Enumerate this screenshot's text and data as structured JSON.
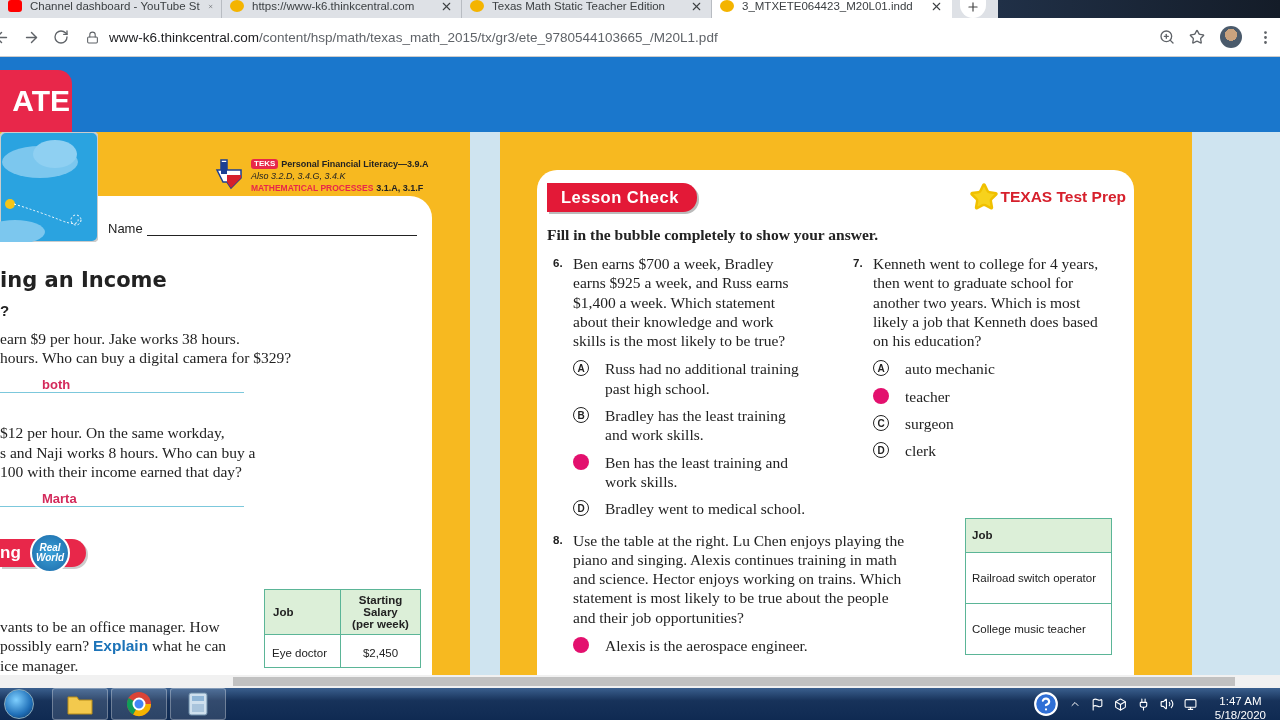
{
  "browser": {
    "tabs": [
      {
        "title": "Channel dashboard - YouTube St",
        "kind": "youtube",
        "selected": false
      },
      {
        "title": "https://www-k6.thinkcentral.com",
        "kind": "site",
        "selected": false
      },
      {
        "title": "Texas Math Static Teacher Edition",
        "kind": "site",
        "selected": false
      },
      {
        "title": "3_MTXETE064423_M20L01.indd",
        "kind": "site",
        "selected": true
      }
    ],
    "url": {
      "host": "www-k6.thinkcentral.com",
      "path": "/content/hsp/math/texas_math_2015/tx/gr3/ete_9780544103665_/M20L1.pdf"
    }
  },
  "viewer": {
    "banner_badge": "ATE"
  },
  "left_page": {
    "teks": {
      "badge": "TEKS",
      "title": "Personal Financial Literacy—3.9.A",
      "also": "Also 3.2.D, 3.4.G, 3.4.K",
      "processes_label": "MATHEMATICAL PROCESSES",
      "processes": "3.1.A, 3.1.F"
    },
    "name_label": "Name",
    "heading": "ing an Income",
    "subheading": "?",
    "problems": [
      {
        "text": "earn $9 per hour. Jake works 38 hours.\nhours. Who can buy a digital camera for $329?",
        "answer": "both"
      },
      {
        "text": "$12 per hour. On the same workday,\ns and Naji works 8 hours. Who can buy a\n100 with their income earned that day?",
        "answer": "Marta"
      }
    ],
    "section_pill": "ng",
    "section_badge": "Real\nWorld",
    "final_problem": {
      "before": "vants to be an office manager. How\npossibly earn? ",
      "term": "Explain",
      "after": " what he can\nice manager."
    },
    "table": {
      "columns": [
        "Job",
        "Starting Salary\n(per week)"
      ],
      "rows": [
        [
          "Eye doctor",
          "$2,450"
        ]
      ]
    }
  },
  "right_page": {
    "lesson_check": "Lesson Check",
    "test_prep": "TEXAS Test Prep",
    "instruction": "Fill in the bubble completely to show your answer.",
    "questions": [
      {
        "number": "6.",
        "text": "Ben earns $700 a week, Bradley\nearns $925 a week, and Russ earns\n$1,400 a week. Which statement\nabout their knowledge and work\nskills is the most likely to be true?",
        "options": [
          {
            "letter": "A",
            "text": "Russ had no additional training\npast high school.",
            "selected": false
          },
          {
            "letter": "B",
            "text": "Bradley has the least training\nand work skills.",
            "selected": false
          },
          {
            "text": "Ben has the least training and\nwork skills.",
            "selected": true
          },
          {
            "letter": "D",
            "text": "Bradley went to medical school.",
            "selected": false
          }
        ]
      },
      {
        "number": "7.",
        "text": "Kenneth went to college for 4 years,\nthen went to graduate school for\nanother two years. Which is most\nlikely a job that Kenneth does based\non his education?",
        "options": [
          {
            "letter": "A",
            "text": "auto mechanic",
            "selected": false
          },
          {
            "text": "teacher",
            "selected": true
          },
          {
            "letter": "C",
            "text": "surgeon",
            "selected": false
          },
          {
            "letter": "D",
            "text": "clerk",
            "selected": false
          }
        ]
      }
    ],
    "question_8": {
      "number": "8.",
      "text": "Use the table at the right. Lu Chen enjoys playing the\npiano and singing. Alexis continues training in math\nand science. Hector enjoys working on trains. Which\nstatement is most likely to be true about the people\nand their job opportunities?",
      "options": [
        {
          "text": "Alexis is the aerospace engineer.",
          "selected": true
        }
      ],
      "table": {
        "column": "Job",
        "rows": [
          "Railroad switch operator",
          "College music teacher"
        ]
      }
    }
  },
  "taskbar": {
    "time": "1:47 AM",
    "date": "5/18/2020"
  }
}
